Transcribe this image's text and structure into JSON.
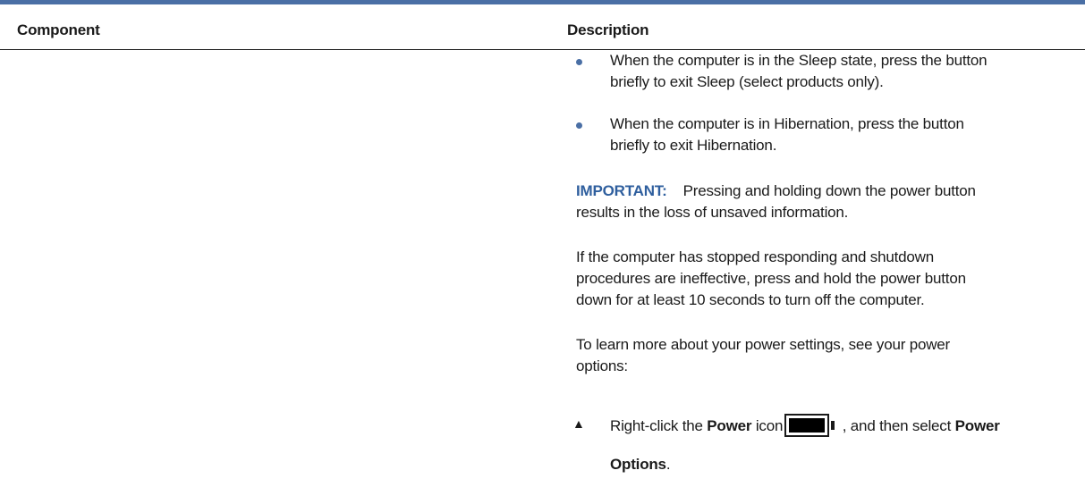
{
  "table": {
    "headers": {
      "component": "Component",
      "description": "Description"
    }
  },
  "description": {
    "bullets": [
      {
        "line1": "When the computer is in the Sleep state, press the button",
        "line2": "briefly to exit Sleep (select products only)."
      },
      {
        "line1": "When the computer is in Hibernation, press the button",
        "line2": "briefly to exit Hibernation."
      }
    ],
    "important": {
      "label": "IMPORTANT:",
      "line1": "Pressing and holding down the power button",
      "line2": "results in the loss of unsaved information."
    },
    "para_unresponsive": {
      "line1": "If the computer has stopped responding and shutdown",
      "line2": "procedures are ineffective, press and hold the power button",
      "line3": "down for at least 10 seconds to turn off the computer."
    },
    "para_learn": {
      "line1": "To learn more about your power settings, see your power",
      "line2": "options:"
    },
    "step": {
      "text_before": "Right-click the ",
      "power_word": "Power",
      "text_icon": " icon",
      "text_after": " , and then select ",
      "power_options_word1": "Power",
      "power_options_word2": "Options",
      "period": "."
    }
  },
  "colors": {
    "accent": "#4a6fa5",
    "important": "#2f5f9e",
    "text": "#1a1a1a"
  },
  "icons": {
    "bullet": "bullet-dot-icon",
    "step": "triangle-step-icon",
    "battery": "battery-icon"
  }
}
